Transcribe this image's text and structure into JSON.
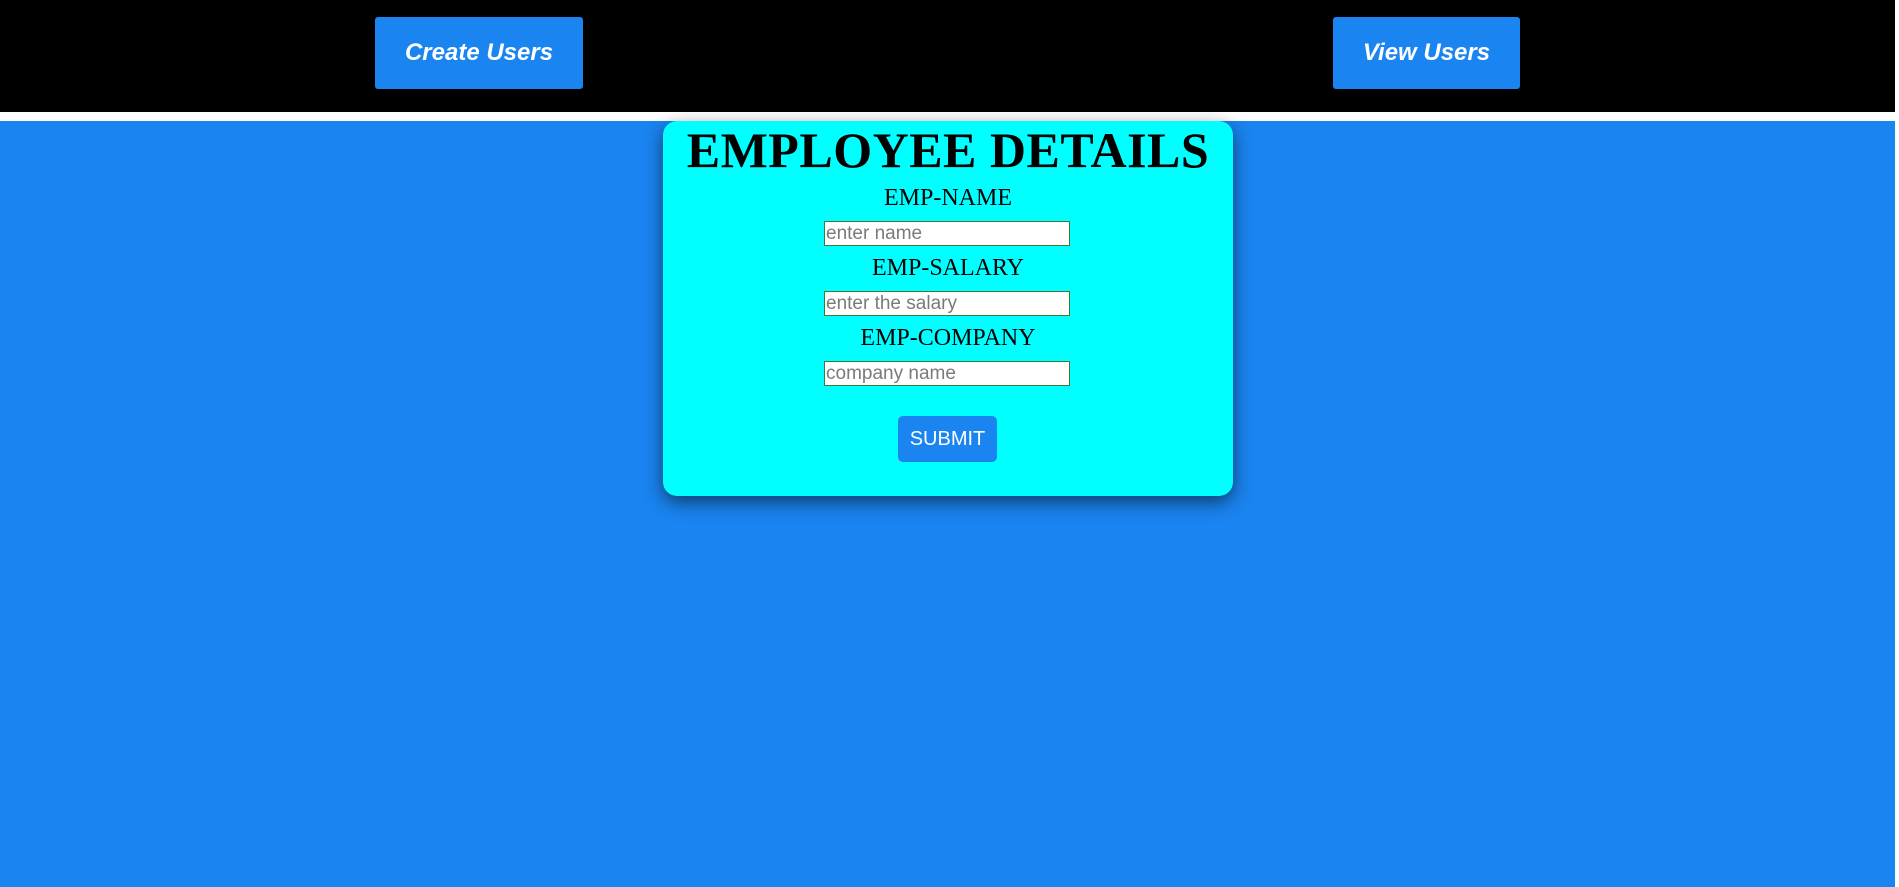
{
  "nav": {
    "create_label": "Create Users",
    "view_label": "View Users"
  },
  "form": {
    "title": "EMPLOYEE DETAILS",
    "name_label": "EMP-NAME",
    "name_placeholder": "enter name",
    "salary_label": "EMP-SALARY",
    "salary_placeholder": "enter the salary",
    "company_label": "EMP-COMPANY",
    "company_placeholder": "company name",
    "submit_label": "SUBMIT"
  },
  "colors": {
    "header_background": "#000000",
    "page_background": "#1a84f0",
    "card_background": "#00ffff",
    "button_background": "#1a84f0",
    "button_text": "#ffffff"
  }
}
